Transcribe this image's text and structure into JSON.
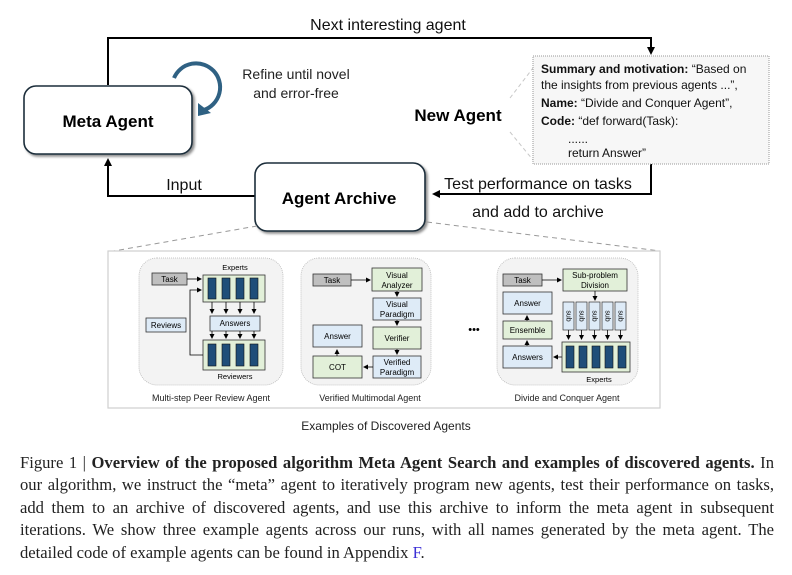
{
  "top": {
    "meta_agent_label": "Meta Agent",
    "agent_archive_label": "Agent Archive",
    "new_agent_label": "New Agent",
    "next_interesting_label": "Next interesting agent",
    "refine_line1": "Refine until novel",
    "refine_line2": "and error-free",
    "input_label": "Input",
    "test_line1": "Test performance on tasks",
    "test_line2": "and add to archive",
    "card": {
      "summary_key": "Summary and motivation:",
      "summary_val1": " “Based on",
      "summary_val2": "the insights from previous agents ...”,",
      "name_key": "Name:",
      "name_val": " “Divide and Conquer Agent”,",
      "code_key": "Code:",
      "code_val": " “def forward(Task):",
      "code_dots": "......",
      "code_return": "return Answer”"
    }
  },
  "examples": {
    "section_label": "Examples of Discovered Agents",
    "ellipsis": "•••",
    "peer_review": {
      "title": "Multi-step Peer Review Agent",
      "task": "Task",
      "experts": "Experts",
      "reviews": "Reviews",
      "answers": "Answers",
      "reviewers": "Reviewers"
    },
    "multimodal": {
      "title": "Verified Multimodal Agent",
      "task": "Task",
      "visual_analyzer_1": "Visual",
      "visual_analyzer_2": "Analyzer",
      "visual_paradigm_1": "Visual",
      "visual_paradigm_2": "Paradigm",
      "verifier": "Verifier",
      "verified_paradigm_1": "Verified",
      "verified_paradigm_2": "Paradigm",
      "answer": "Answer",
      "cot": "COT"
    },
    "divide_conquer": {
      "title": "Divide and Conquer Agent",
      "task": "Task",
      "subproblem_1": "Sub-problem",
      "subproblem_2": "Division",
      "answer": "Answer",
      "ensemble": "Ensemble",
      "answers": "Answers",
      "sub": "sub",
      "experts": "Experts"
    }
  },
  "caption": {
    "prefix": "Figure 1 | ",
    "bold": "Overview of the proposed algorithm Meta Agent Search and examples of discovered agents.",
    "body": " In our algorithm, we instruct the “meta” agent to iteratively program new agents, test their performance on tasks, add them to an archive of discovered agents, and use this archive to inform the meta agent in subsequent iterations. We show three example agents across our runs, with all names generated by the meta agent. The detailed code of example agents can be found in Appendix ",
    "link": "F",
    "end": "."
  },
  "colors": {
    "refine_arrow": "#2f6183",
    "green_box": "#e2f0d9",
    "blue_box": "#deebf7",
    "gray_box": "#bfbfbf",
    "dark_bar": "#1f4e79",
    "link": "#3b2fd6"
  }
}
